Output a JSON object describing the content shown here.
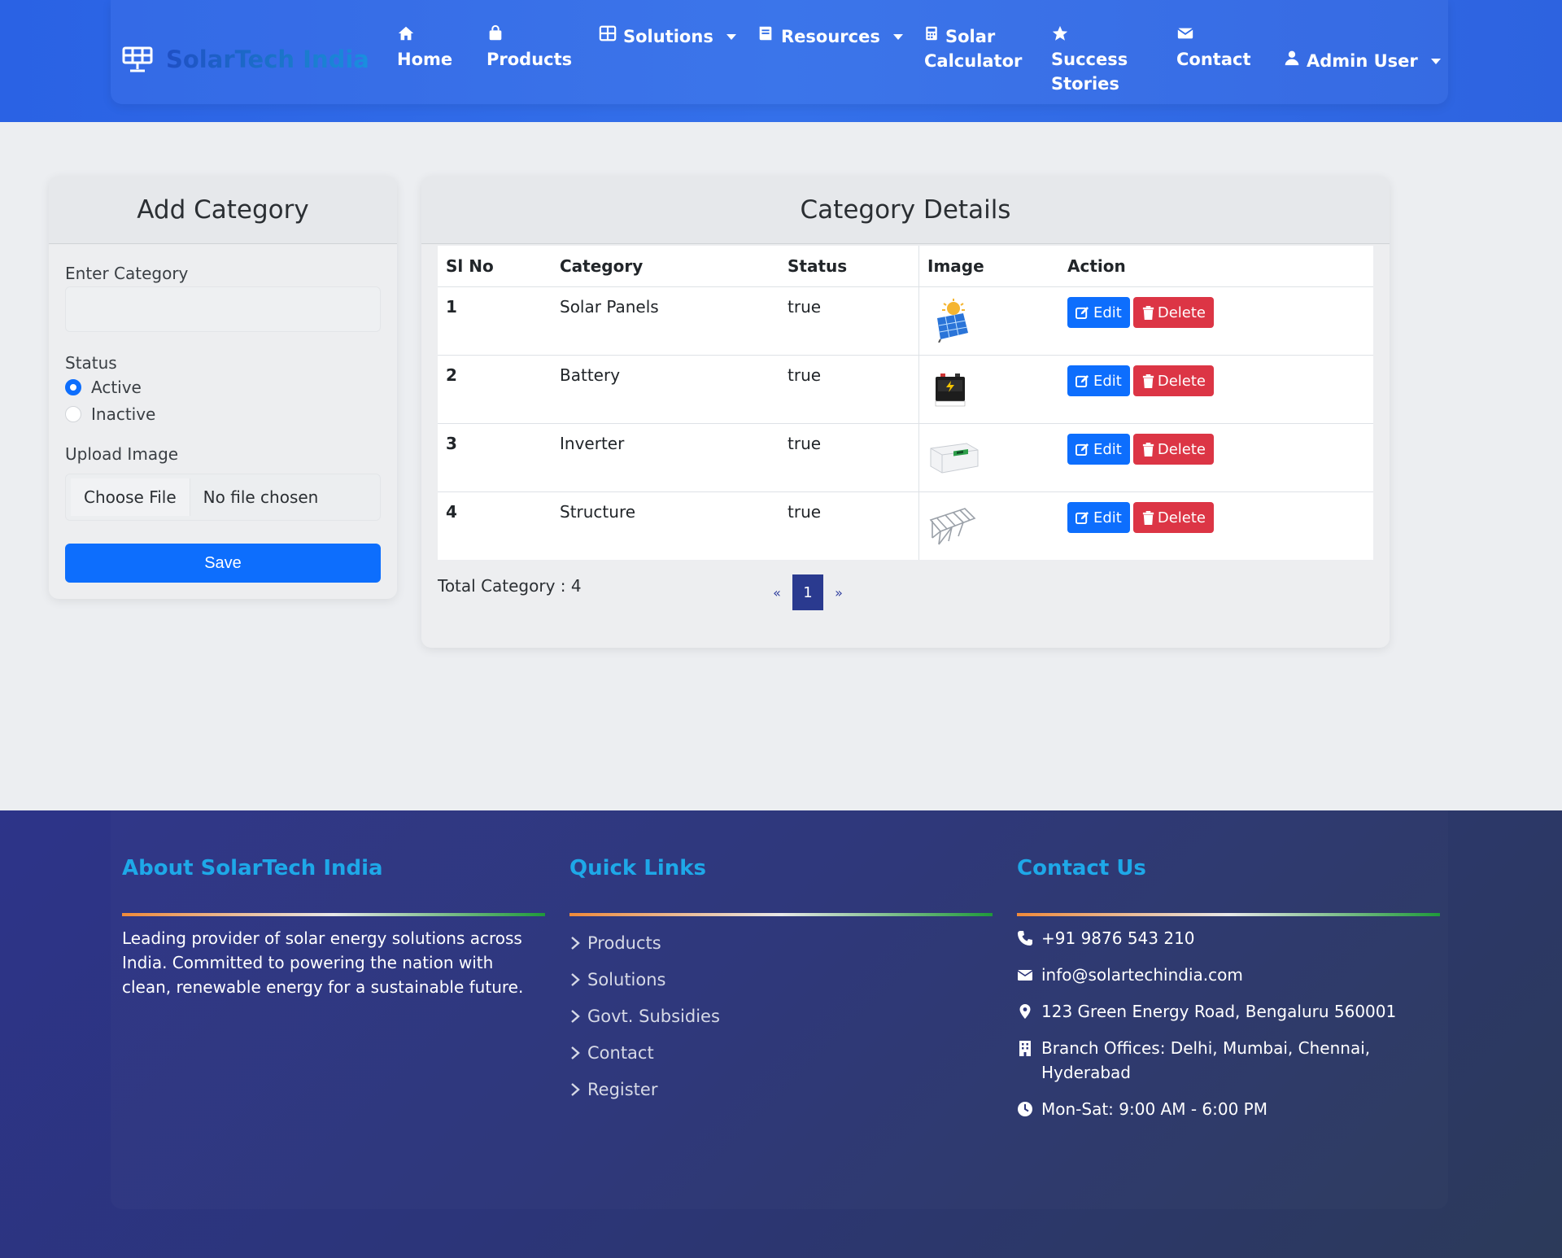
{
  "brand": {
    "name": "SolarTech India"
  },
  "nav": {
    "home": "Home",
    "products": "Products",
    "solutions": "Solutions",
    "resources": "Resources",
    "calc_line1": "Solar",
    "calc_line2": "Calculator",
    "stories_line1": "Success",
    "stories_line2": "Stories",
    "contact": "Contact",
    "user": "Admin User"
  },
  "add_category": {
    "title": "Add Category",
    "enter_label": "Enter Category",
    "input_value": "",
    "status_label": "Status",
    "active_label": "Active",
    "inactive_label": "Inactive",
    "upload_label": "Upload Image",
    "choose_file": "Choose File",
    "no_file": "No file chosen",
    "save": "Save"
  },
  "details": {
    "title": "Category Details",
    "headers": [
      "Sl No",
      "Category",
      "Status",
      "Image",
      "Action"
    ],
    "rows": [
      {
        "no": "1",
        "category": "Solar Panels",
        "status": "true",
        "image": "solar-panel-icon"
      },
      {
        "no": "2",
        "category": "Battery",
        "status": "true",
        "image": "battery-icon"
      },
      {
        "no": "3",
        "category": "Inverter",
        "status": "true",
        "image": "inverter-icon"
      },
      {
        "no": "4",
        "category": "Structure",
        "status": "true",
        "image": "structure-icon"
      }
    ],
    "edit": "Edit",
    "delete": "Delete",
    "total": "Total Category : 4",
    "pager_prev": "«",
    "pager_page": "1",
    "pager_next": "»"
  },
  "footer": {
    "about_title": "About SolarTech India",
    "about_text": "Leading provider of solar energy solutions across India. Committed to powering the nation with clean, renewable energy for a sustainable future.",
    "links_title": "Quick Links",
    "links": [
      "Products",
      "Solutions",
      "Govt. Subsidies",
      "Contact",
      "Register"
    ],
    "contact_title": "Contact Us",
    "phone": "+91 9876 543 210",
    "email": "info@solartechindia.com",
    "address": "123 Green Energy Road, Bengaluru 560001",
    "branches": "Branch Offices: Delhi, Mumbai, Chennai, Hyderabad",
    "hours": "Mon-Sat: 9:00 AM - 6:00 PM"
  },
  "colors": {
    "primary": "#0d6efd",
    "danger": "#dc3545",
    "nav": "#2f6be6",
    "footer": "#2c3579",
    "accent": "#1ea8e8"
  }
}
